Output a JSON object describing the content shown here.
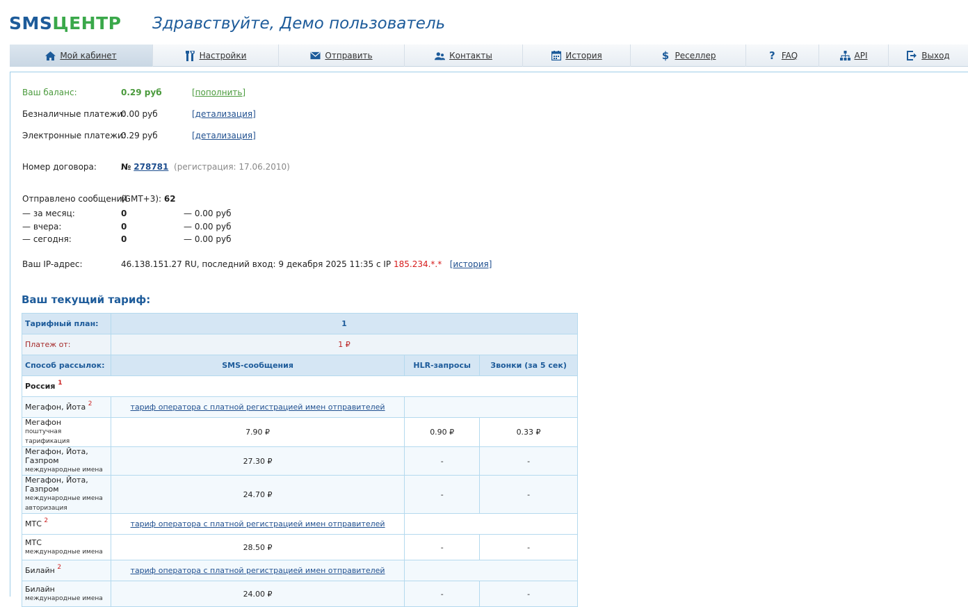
{
  "header": {
    "logo_part1": "SMS",
    "logo_part2": "ЦЕНТР",
    "greeting": "Здравствуйте, Демо пользователь"
  },
  "nav": [
    {
      "label": "Мой кабинет",
      "icon": "home-icon"
    },
    {
      "label": "Настройки",
      "icon": "tools-icon"
    },
    {
      "label": "Отправить",
      "icon": "envelope-icon"
    },
    {
      "label": "Контакты",
      "icon": "users-icon"
    },
    {
      "label": "История",
      "icon": "calendar-icon"
    },
    {
      "label": "Реселлер",
      "icon": "dollar-icon"
    },
    {
      "label": "FAQ",
      "icon": "question-icon"
    },
    {
      "label": "API",
      "icon": "sitemap-icon"
    },
    {
      "label": "Выход",
      "icon": "logout-icon"
    }
  ],
  "account": {
    "balance_label": "Ваш баланс:",
    "balance_value": "0.29 руб",
    "balance_link": "[пополнить]",
    "cashless_label": "Безналичные платежи:",
    "cashless_value": "0.00 руб",
    "cashless_link": "[детализация]",
    "electronic_label": "Электронные платежи:",
    "electronic_value": "0.29 руб",
    "electronic_link": "[детализация]",
    "contract_label": "Номер договора:",
    "contract_prefix": "№",
    "contract_number": "278781",
    "contract_reg": "(регистрация: 17.06.2010)",
    "sent_label": "Отправлено сообщений",
    "sent_tz": "(GMT+3):",
    "sent_total": "62",
    "month_label": "— за месяц:",
    "month_count": "0",
    "month_sum": "— 0.00 руб",
    "yesterday_label": "— вчера:",
    "yesterday_count": "0",
    "yesterday_sum": "— 0.00 руб",
    "today_label": "— сегодня:",
    "today_count": "0",
    "today_sum": "— 0.00 руб",
    "ip_label": "Ваш IP-адрес:",
    "ip_text": "46.138.151.27 RU, последний вход: 9 декабря 2025 11:35 с IP",
    "ip_last": "185.234.*.*",
    "ip_link": "[история]"
  },
  "tariff": {
    "title": "Ваш текущий тариф:",
    "plan_label": "Тарифный план:",
    "plan_value": "1",
    "payment_label": "Платеж от:",
    "payment_value": "1 ₽",
    "method_label": "Способ рассылок:",
    "col_sms": "SMS-сообщения",
    "col_hlr": "HLR-запросы",
    "col_calls": "Звонки (за 5 сек)",
    "country": "Россия",
    "country_note": "1",
    "operator_link": "тариф оператора с платной регистрацией имен отправителей",
    "rows": {
      "megafon_yota": {
        "name": "Мегафон, Йота",
        "note": "2"
      },
      "megafon": {
        "name": "Мегафон",
        "sub": "поштучная тарификация",
        "sms": "7.90 ₽",
        "hlr": "0.90 ₽",
        "calls": "0.33 ₽"
      },
      "mgp_intl": {
        "name": "Мегафон, Йота, Газпром",
        "sub": "международные имена",
        "sms": "27.30 ₽",
        "hlr": "-",
        "calls": "-"
      },
      "mgp_auth": {
        "name": "Мегафон, Йота, Газпром",
        "sub1": "международные имена",
        "sub2": "авторизация",
        "sms": "24.70 ₽",
        "hlr": "-",
        "calls": "-"
      },
      "mts_op": {
        "name": "МТС",
        "note": "2"
      },
      "mts": {
        "name": "МТС",
        "sub": "международные имена",
        "sms": "28.50 ₽",
        "hlr": "-",
        "calls": "-"
      },
      "beeline_op": {
        "name": "Билайн",
        "note": "2"
      },
      "beeline": {
        "name": "Билайн",
        "sub": "международные имена",
        "sms": "24.00 ₽",
        "hlr": "-",
        "calls": "-"
      }
    }
  }
}
